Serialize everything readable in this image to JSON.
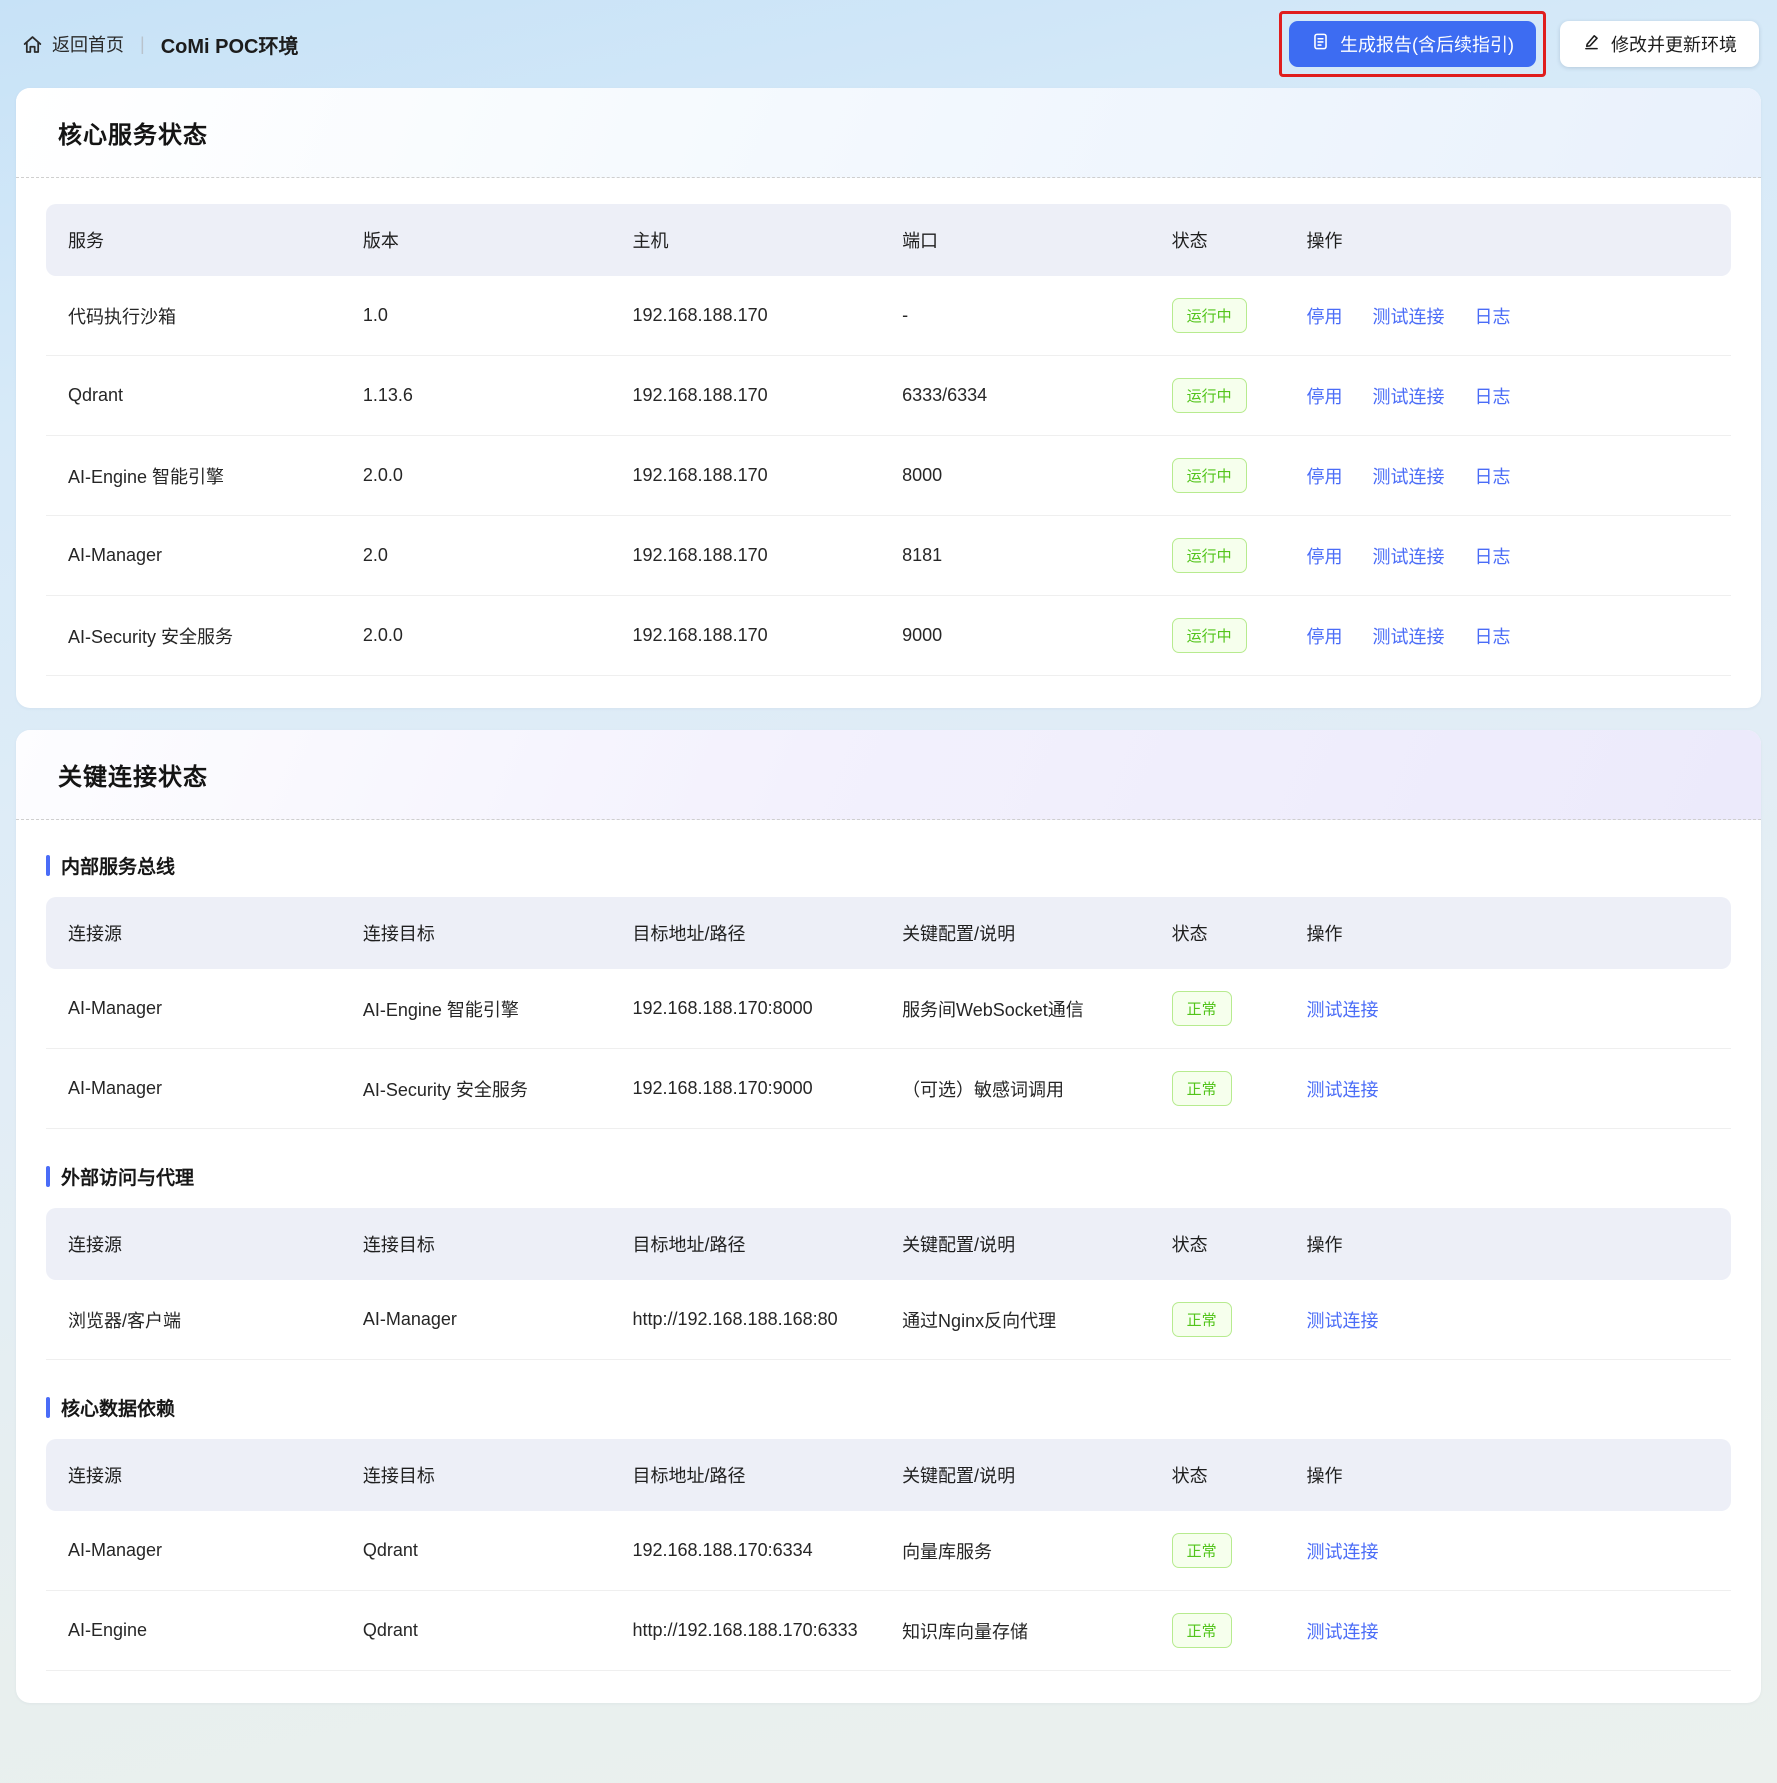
{
  "topbar": {
    "back_home": "返回首页",
    "separator": "|",
    "env_title": "CoMi POC环境",
    "generate_report_button": "生成报告(含后续指引)",
    "update_env_button": "修改并更新环境"
  },
  "colors": {
    "primary_button": "#3d6cf2",
    "link": "#4a6cf7",
    "status_text": "#52c41a",
    "status_bg": "#f6ffed",
    "status_border": "#b7eb8f",
    "highlight_box": "#e01d1d"
  },
  "core_services": {
    "title": "核心服务状态",
    "columns": [
      "服务",
      "版本",
      "主机",
      "端口",
      "状态",
      "操作"
    ],
    "rows": [
      {
        "service": "代码执行沙箱",
        "version": "1.0",
        "host": "192.168.188.170",
        "port": "-",
        "status": "运行中",
        "actions": [
          "停用",
          "测试连接",
          "日志"
        ]
      },
      {
        "service": "Qdrant",
        "version": "1.13.6",
        "host": "192.168.188.170",
        "port": "6333/6334",
        "status": "运行中",
        "actions": [
          "停用",
          "测试连接",
          "日志"
        ]
      },
      {
        "service": "AI-Engine 智能引擎",
        "version": "2.0.0",
        "host": "192.168.188.170",
        "port": "8000",
        "status": "运行中",
        "actions": [
          "停用",
          "测试连接",
          "日志"
        ]
      },
      {
        "service": "AI-Manager",
        "version": "2.0",
        "host": "192.168.188.170",
        "port": "8181",
        "status": "运行中",
        "actions": [
          "停用",
          "测试连接",
          "日志"
        ]
      },
      {
        "service": "AI-Security 安全服务",
        "version": "2.0.0",
        "host": "192.168.188.170",
        "port": "9000",
        "status": "运行中",
        "actions": [
          "停用",
          "测试连接",
          "日志"
        ]
      }
    ]
  },
  "connections": {
    "title": "关键连接状态",
    "columns": [
      "连接源",
      "连接目标",
      "目标地址/路径",
      "关键配置/说明",
      "状态",
      "操作"
    ],
    "groups": [
      {
        "name": "内部服务总线",
        "rows": [
          {
            "source": "AI-Manager",
            "target": "AI-Engine 智能引擎",
            "address": "192.168.188.170:8000",
            "config": "服务间WebSocket通信",
            "status": "正常",
            "action": "测试连接"
          },
          {
            "source": "AI-Manager",
            "target": "AI-Security 安全服务",
            "address": "192.168.188.170:9000",
            "config": "（可选）敏感词调用",
            "status": "正常",
            "action": "测试连接"
          }
        ]
      },
      {
        "name": "外部访问与代理",
        "rows": [
          {
            "source": "浏览器/客户端",
            "target": "AI-Manager",
            "address": "http://192.168.188.168:80",
            "config": "通过Nginx反向代理",
            "status": "正常",
            "action": "测试连接"
          }
        ]
      },
      {
        "name": "核心数据依赖",
        "rows": [
          {
            "source": "AI-Manager",
            "target": "Qdrant",
            "address": "192.168.188.170:6334",
            "config": "向量库服务",
            "status": "正常",
            "action": "测试连接"
          },
          {
            "source": "AI-Engine",
            "target": "Qdrant",
            "address": "http://192.168.188.170:6333",
            "config": "知识库向量存储",
            "status": "正常",
            "action": "测试连接"
          }
        ]
      }
    ]
  }
}
